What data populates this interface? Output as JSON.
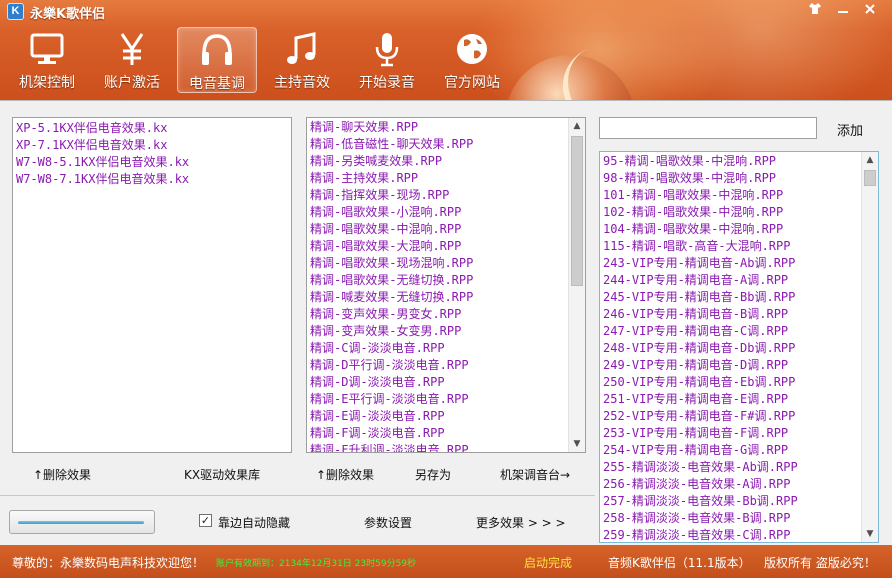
{
  "window": {
    "title": "永樂K歌伴侣",
    "icon_letter": "K",
    "controls": [
      "shirt",
      "minimize",
      "close"
    ]
  },
  "nav": {
    "tabs": [
      {
        "label": "机架控制",
        "icon": "monitor-icon",
        "active": false
      },
      {
        "label": "账户激活",
        "icon": "yen-icon",
        "active": false
      },
      {
        "label": "电音基调",
        "icon": "headphones-icon",
        "active": true
      },
      {
        "label": "主持音效",
        "icon": "music-note-icon",
        "active": false
      },
      {
        "label": "开始录音",
        "icon": "microphone-icon",
        "active": false
      },
      {
        "label": "官方网站",
        "icon": "globe-icon",
        "active": false
      }
    ]
  },
  "left_list": {
    "items": [
      "XP-5.1KX伴侣电音效果.kx",
      "XP-7.1KX伴侣电音效果.kx",
      "W7-W8-5.1KX伴侣电音效果.kx",
      "W7-W8-7.1KX伴侣电音效果.kx"
    ]
  },
  "middle_list": {
    "items": [
      "精调-聊天效果.RPP",
      "精调-低音磁性-聊天效果.RPP",
      "精调-另类喊麦效果.RPP",
      "精调-主持效果.RPP",
      "精调-指挥效果-现场.RPP",
      "精调-唱歌效果-小混响.RPP",
      "精调-唱歌效果-中混响.RPP",
      "精调-唱歌效果-大混响.RPP",
      "精调-唱歌效果-现场混响.RPP",
      "精调-唱歌效果-无缝切换.RPP",
      "精调-喊麦效果-无缝切换.RPP",
      "精调-变声效果-男变女.RPP",
      "精调-变声效果-女变男.RPP",
      "精调-C调-淡淡电音.RPP",
      "精调-D平行调-淡淡电音.RPP",
      "精调-D调-淡淡电音.RPP",
      "精调-E平行调-淡淡电音.RPP",
      "精调-E调-淡淡电音.RPP",
      "精调-F调-淡淡电音.RPP",
      "精调-F升利调-淡淡电音.RPP"
    ]
  },
  "right_panel": {
    "input_value": "",
    "add_label": "添加",
    "items": [
      "95-精调-唱歌效果-中混响.RPP",
      "98-精调-唱歌效果-中混响.RPP",
      "101-精调-唱歌效果-中混响.RPP",
      "102-精调-唱歌效果-中混响.RPP",
      "104-精调-唱歌效果-中混响.RPP",
      "115-精调-唱歌-高音-大混响.RPP",
      "243-VIP专用-精调电音-Ab调.RPP",
      "244-VIP专用-精调电音-A调.RPP",
      "245-VIP专用-精调电音-Bb调.RPP",
      "246-VIP专用-精调电音-B调.RPP",
      "247-VIP专用-精调电音-C调.RPP",
      "248-VIP专用-精调电音-Db调.RPP",
      "249-VIP专用-精调电音-D调.RPP",
      "250-VIP专用-精调电音-Eb调.RPP",
      "251-VIP专用-精调电音-E调.RPP",
      "252-VIP专用-精调电音-F#调.RPP",
      "253-VIP专用-精调电音-F调.RPP",
      "254-VIP专用-精调电音-G调.RPP",
      "255-精调淡淡-电音效果-Ab调.RPP",
      "256-精调淡淡-电音效果-A调.RPP",
      "257-精调淡淡-电音效果-Bb调.RPP",
      "258-精调淡淡-电音效果-B调.RPP",
      "259-精调淡淡-电音效果-C调.RPP"
    ]
  },
  "actions": {
    "delete_left": "↑删除效果",
    "kx_driver_lib": "KX驱动效果库",
    "delete_mid": "↑删除效果",
    "save_as": "另存为",
    "rack_console": "机架调音台→"
  },
  "bottom": {
    "progress_fraction": 1.0,
    "autohide_label": "靠边自动隐藏",
    "autohide_checked": true,
    "autohide_mark": "✓",
    "params_label": "参数设置",
    "more_label": "更多效果 > > >"
  },
  "statusbar": {
    "welcome": "尊敬的：永樂数码电声科技欢迎您！",
    "account_status": "账户有效期到：2134年12月31日 23时59分59秒",
    "launch_status": "启动完成",
    "version": "音频K歌伴侣（11.1版本）",
    "copyright": "版权所有 盗版必究！"
  },
  "colors": {
    "accent_orange": "#d9612a",
    "list_text": "#8a1ab0",
    "status_green": "#3df03d",
    "status_yellow": "#ffe23d"
  }
}
